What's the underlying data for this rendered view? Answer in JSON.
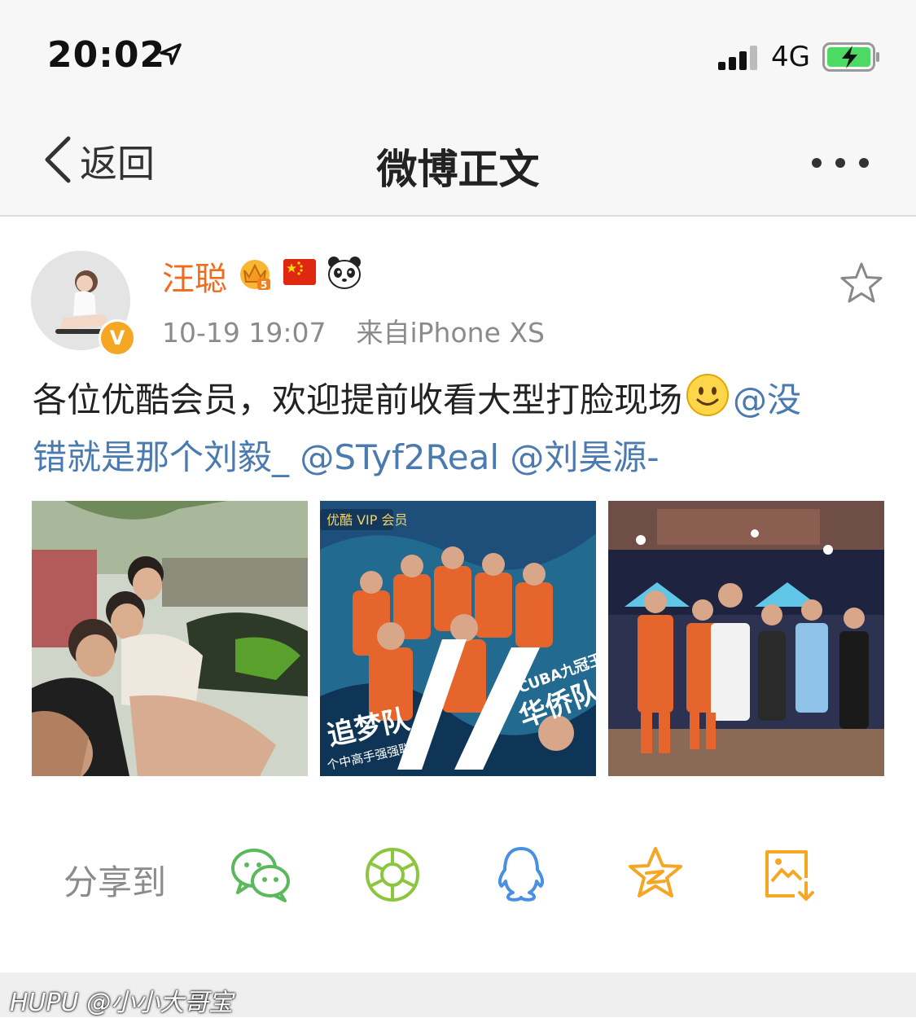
{
  "status_bar": {
    "time": "20:02",
    "network": "4G"
  },
  "nav": {
    "back_label": "返回",
    "title": "微博正文"
  },
  "post": {
    "author": "汪聪",
    "time": "10-19 19:07",
    "source": "来自iPhone XS",
    "text_line1": "各位优酷会员，欢迎提前收看大型打脸现场",
    "mention1_part1": "@没",
    "mention1_part2": "错就是那个刘毅_",
    "mention2": "@STyf2Real",
    "mention3": "@刘昊源-",
    "badge_icons": [
      "crown-level-5-icon",
      "china-flag-icon",
      "panda-icon"
    ]
  },
  "images": {
    "img2_badge": "优酷 VIP 会员",
    "img2_left_team": "追梦队",
    "img2_left_sub": "个中高手强强联合",
    "img2_right_tag": "CUBA九冠王",
    "img2_right_team": "华侨队"
  },
  "share": {
    "label": "分享到",
    "icons": [
      "wechat-icon",
      "moments-icon",
      "qq-icon",
      "qzone-icon",
      "save-image-icon"
    ]
  },
  "colors": {
    "orange": "#f26b1d",
    "link": "#4a7ab0",
    "gray": "#8b8b8b",
    "green": "#5cb85c",
    "blue": "#4a90e2",
    "gold": "#f5a623"
  },
  "watermark": "HUPU @小小大哥宝"
}
